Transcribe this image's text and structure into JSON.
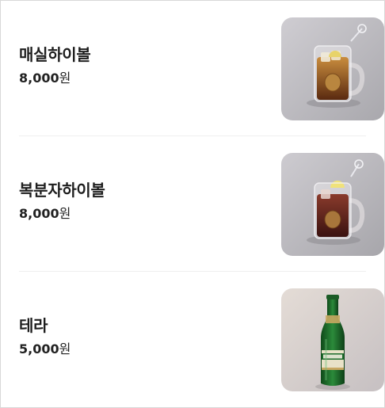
{
  "menu": {
    "items": [
      {
        "name": "매실하이볼",
        "price": "8,000",
        "currency": "원",
        "image": "maesil-highball-mug-image"
      },
      {
        "name": "복분자하이볼",
        "price": "8,000",
        "currency": "원",
        "image": "bokbunja-highball-mug-image"
      },
      {
        "name": "테라",
        "price": "5,000",
        "currency": "원",
        "image": "terra-beer-bottle-image"
      }
    ]
  },
  "colors": {
    "text": "#1e1e1e",
    "divider": "#efefef",
    "frame_border": "#d8d8d8",
    "photo_bg": "#bdbcbf",
    "bottle_green": "#1f6b2a"
  }
}
